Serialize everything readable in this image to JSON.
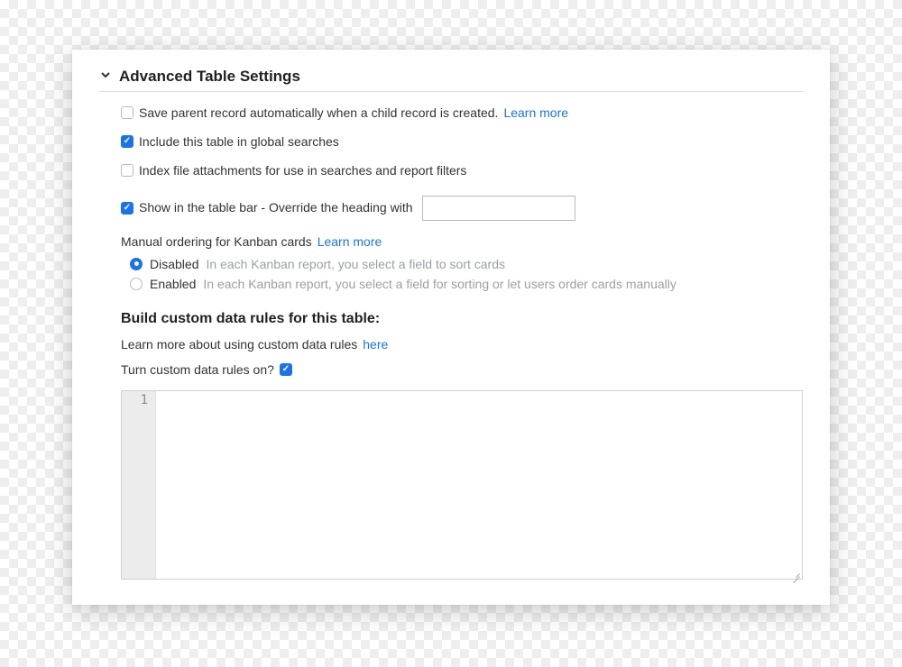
{
  "section": {
    "title": "Advanced Table Settings"
  },
  "options": {
    "saveParent": {
      "checked": false,
      "label": "Save parent record automatically when a child record is created. ",
      "learnMore": "Learn more"
    },
    "globalSearch": {
      "checked": true,
      "label": "Include this table in global searches"
    },
    "indexAttachments": {
      "checked": false,
      "label": "Index file attachments for use in searches and report filters"
    },
    "tableBar": {
      "checked": true,
      "label": "Show in the table bar - Override the heading with",
      "value": ""
    }
  },
  "kanban": {
    "title": "Manual ordering for Kanban cards ",
    "learnMore": "Learn more",
    "disabled": {
      "selected": true,
      "label": "Disabled",
      "desc": "In each Kanban report, you select a field to sort cards"
    },
    "enabled": {
      "selected": false,
      "label": "Enabled",
      "desc": "In each Kanban report, you select a field for sorting or let users order cards manually"
    }
  },
  "customRules": {
    "heading": "Build custom data rules for this table:",
    "learnText": "Learn more about using custom data rules ",
    "learnLink": "here",
    "toggleLabel": "Turn custom data rules on?  ",
    "toggleChecked": true,
    "lineNumber": "1"
  }
}
